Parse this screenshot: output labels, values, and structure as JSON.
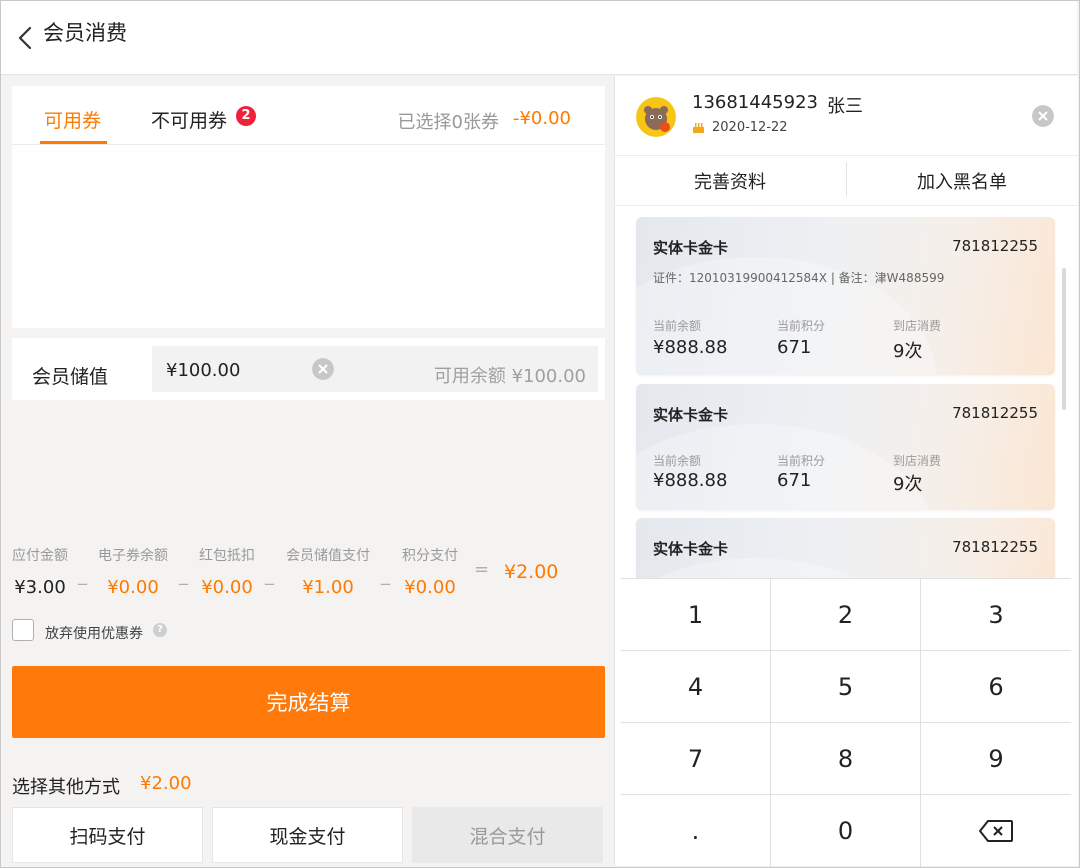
{
  "header": {
    "title": "会员消费"
  },
  "coupons": {
    "tab_available": "可用券",
    "tab_unavailable": "不可用券",
    "unavailable_badge": "2",
    "selected_text": "已选择0张券",
    "selected_amount": "-¥0.00"
  },
  "stored_value": {
    "label": "会员储值",
    "input_value": "¥100.00",
    "balance_text": "可用余额 ¥100.00"
  },
  "calc": {
    "items": [
      {
        "label": "应付金额",
        "value": "¥3.00"
      },
      {
        "label": "电子券余额",
        "value": "¥0.00"
      },
      {
        "label": "红包抵扣",
        "value": "¥0.00"
      },
      {
        "label": "会员储值支付",
        "value": "¥1.00"
      },
      {
        "label": "积分支付",
        "value": "¥0.00"
      }
    ],
    "minus": "_",
    "equals": "=",
    "total": "¥2.00"
  },
  "abandon_coupon_label": "放弃使用优惠券",
  "finish_button": "完成结算",
  "other_payment": {
    "label": "选择其他方式",
    "amount": "¥2.00",
    "buttons": [
      "扫码支付",
      "现金支付",
      "混合支付"
    ]
  },
  "member": {
    "phone": "13681445923",
    "name": "张三",
    "birthday": "2020-12-22",
    "actions": [
      "完善资料",
      "加入黑名单"
    ]
  },
  "cards": [
    {
      "title": "实体卡金卡",
      "number": "781812255",
      "detail": "证件：12010319900412584X  |  备注：津W488599",
      "stats": [
        {
          "label": "当前余额",
          "value": "¥888.88"
        },
        {
          "label": "当前积分",
          "value": "671"
        },
        {
          "label": "到店消费",
          "value": "9次"
        }
      ]
    },
    {
      "title": "实体卡金卡",
      "number": "781812255",
      "stats": [
        {
          "label": "当前余额",
          "value": "¥888.88"
        },
        {
          "label": "当前积分",
          "value": "671"
        },
        {
          "label": "到店消费",
          "value": "9次"
        }
      ]
    },
    {
      "title": "实体卡金卡",
      "number": "781812255"
    }
  ],
  "keypad": [
    "1",
    "2",
    "3",
    "4",
    "5",
    "6",
    "7",
    "8",
    "9",
    ".",
    "0"
  ],
  "colors": {
    "accent": "#ff7a00",
    "badge": "#f0223a"
  }
}
